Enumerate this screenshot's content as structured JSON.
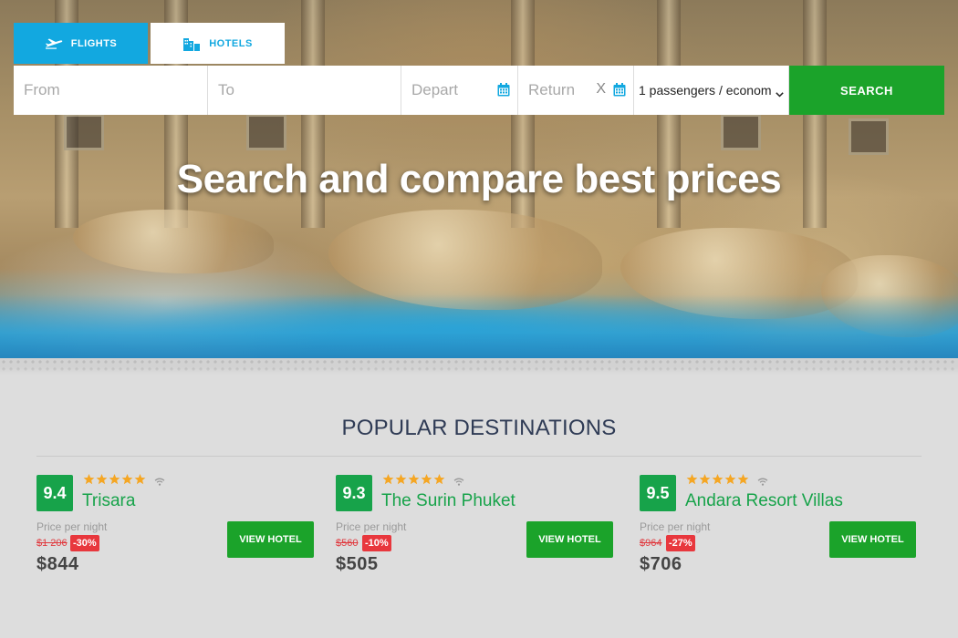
{
  "tabs": [
    {
      "label": "FLIGHTS",
      "icon": "airplane-icon",
      "active": true
    },
    {
      "label": "HOTELS",
      "icon": "hotel-icon",
      "active": false
    }
  ],
  "search": {
    "from_placeholder": "From",
    "to_placeholder": "To",
    "depart_placeholder": "Depart",
    "return_placeholder": "Return",
    "return_clear": "X",
    "passengers": "1 passengers / econom",
    "button": "SEARCH"
  },
  "hero": {
    "title": "Search and compare best prices"
  },
  "section": {
    "title": "POPULAR DESTINATIONS"
  },
  "hotels": [
    {
      "score": "9.4",
      "name": "Trisara",
      "price_label": "Price per night",
      "old_price": "$1 206",
      "discount": "-30%",
      "price": "$844",
      "button": "VIEW HOTEL",
      "stars": 5
    },
    {
      "score": "9.3",
      "name": "The Surin Phuket",
      "price_label": "Price per night",
      "old_price": "$560",
      "discount": "-10%",
      "price": "$505",
      "button": "VIEW HOTEL",
      "stars": 5
    },
    {
      "score": "9.5",
      "name": "Andara Resort Villas",
      "price_label": "Price per night",
      "old_price": "$964",
      "discount": "-27%",
      "price": "$706",
      "button": "VIEW HOTEL",
      "stars": 5
    }
  ],
  "colors": {
    "accent_blue": "#12a8e0",
    "green": "#1ba32a",
    "score_green": "#17a34a",
    "discount_red": "#e8373d",
    "star": "#f5a623"
  }
}
